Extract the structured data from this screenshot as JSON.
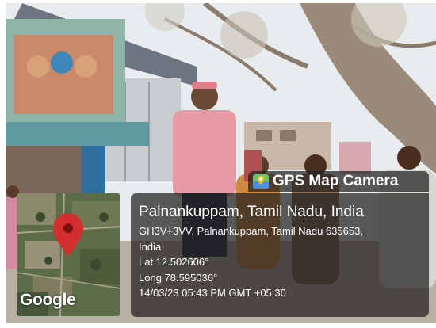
{
  "badge": {
    "icon": "map-camera-icon",
    "text": "GPS Map Camera"
  },
  "map": {
    "pin_icon": "location-pin-icon",
    "pin_color": "#d32f2f",
    "logo_text": "Google"
  },
  "location": {
    "title": "Palnankuppam, Tamil Nadu, India",
    "address_line1": "GH3V+3VV, Palnankuppam, Tamil Nadu 635653,",
    "address_line2": "India",
    "lat": "Lat 12.502606°",
    "long": "Long 78.595036°",
    "datetime": "14/03/23 05:43 PM GMT +05:30"
  },
  "colors": {
    "panel_bg": "#1e1e1e",
    "text": "#ffffff"
  }
}
